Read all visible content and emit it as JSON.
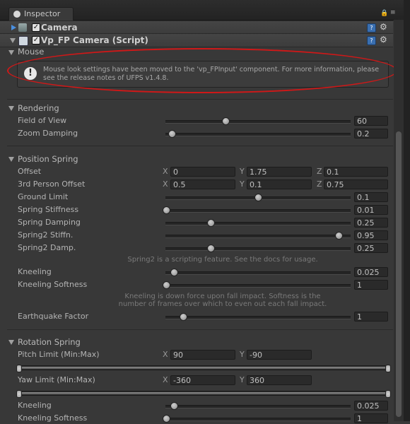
{
  "window": {
    "tab_title": "Inspector"
  },
  "components": {
    "camera": {
      "label": "Camera",
      "enabled": true
    },
    "script": {
      "label": "Vp_FP Camera (Script)",
      "enabled": true
    }
  },
  "mouse": {
    "section": "Mouse",
    "info": "Mouse look settings have been moved to the 'vp_FPInput' component. For more information, please see the release notes of UFPS v1.4.8."
  },
  "rendering": {
    "section": "Rendering",
    "fov": {
      "label": "Field of View",
      "value": "60",
      "fraction": 0.34
    },
    "zoom_damping": {
      "label": "Zoom Damping",
      "value": "0.2",
      "fraction": 0.03
    }
  },
  "position_spring": {
    "section": "Position Spring",
    "offset": {
      "label": "Offset",
      "x": "0",
      "y": "1.75",
      "z": "0.1"
    },
    "third_person_offset": {
      "label": "3rd Person Offset",
      "x": "0.5",
      "y": "0.1",
      "z": "0.75"
    },
    "ground_limit": {
      "label": "Ground Limit",
      "value": "0.1",
      "fraction": 0.5
    },
    "spring_stiffness": {
      "label": "Spring Stiffness",
      "value": "0.01",
      "fraction": 0.0
    },
    "spring_damping": {
      "label": "Spring Damping",
      "value": "0.25",
      "fraction": 0.24
    },
    "spring2_stiffn": {
      "label": "Spring2 Stiffn.",
      "value": "0.95",
      "fraction": 0.96
    },
    "spring2_damp": {
      "label": "Spring2 Damp.",
      "value": "0.25",
      "fraction": 0.24
    },
    "spring2_note": "Spring2 is a scripting feature. See the docs for usage.",
    "kneeling": {
      "label": "Kneeling",
      "value": "0.025",
      "fraction": 0.04
    },
    "kneeling_softness": {
      "label": "Kneeling Softness",
      "value": "1",
      "fraction": 0.0
    },
    "kneeling_note_1": "Kneeling is down force upon fall impact. Softness is the",
    "kneeling_note_2": "number of frames over which to even out each fall impact.",
    "earthquake_factor": {
      "label": "Earthquake Factor",
      "value": "1",
      "fraction": 0.09
    }
  },
  "rotation_spring": {
    "section": "Rotation Spring",
    "pitch_limit": {
      "label": "Pitch Limit (Min:Max)",
      "x": "90",
      "y": "-90"
    },
    "yaw_limit": {
      "label": "Yaw Limit (Min:Max)",
      "x": "-360",
      "y": "360"
    },
    "kneeling": {
      "label": "Kneeling",
      "value": "0.025",
      "fraction": 0.04
    },
    "kneeling_softness": {
      "label": "Kneeling Softness",
      "value": "1",
      "fraction": 0.0
    }
  },
  "axis_labels": {
    "x": "X",
    "y": "Y",
    "z": "Z"
  },
  "icons": {
    "help": "?",
    "gear": "⚙",
    "info": "!"
  },
  "colors": {
    "annotation_ring": "#d01818",
    "help_blue": "#3a6fb0"
  }
}
